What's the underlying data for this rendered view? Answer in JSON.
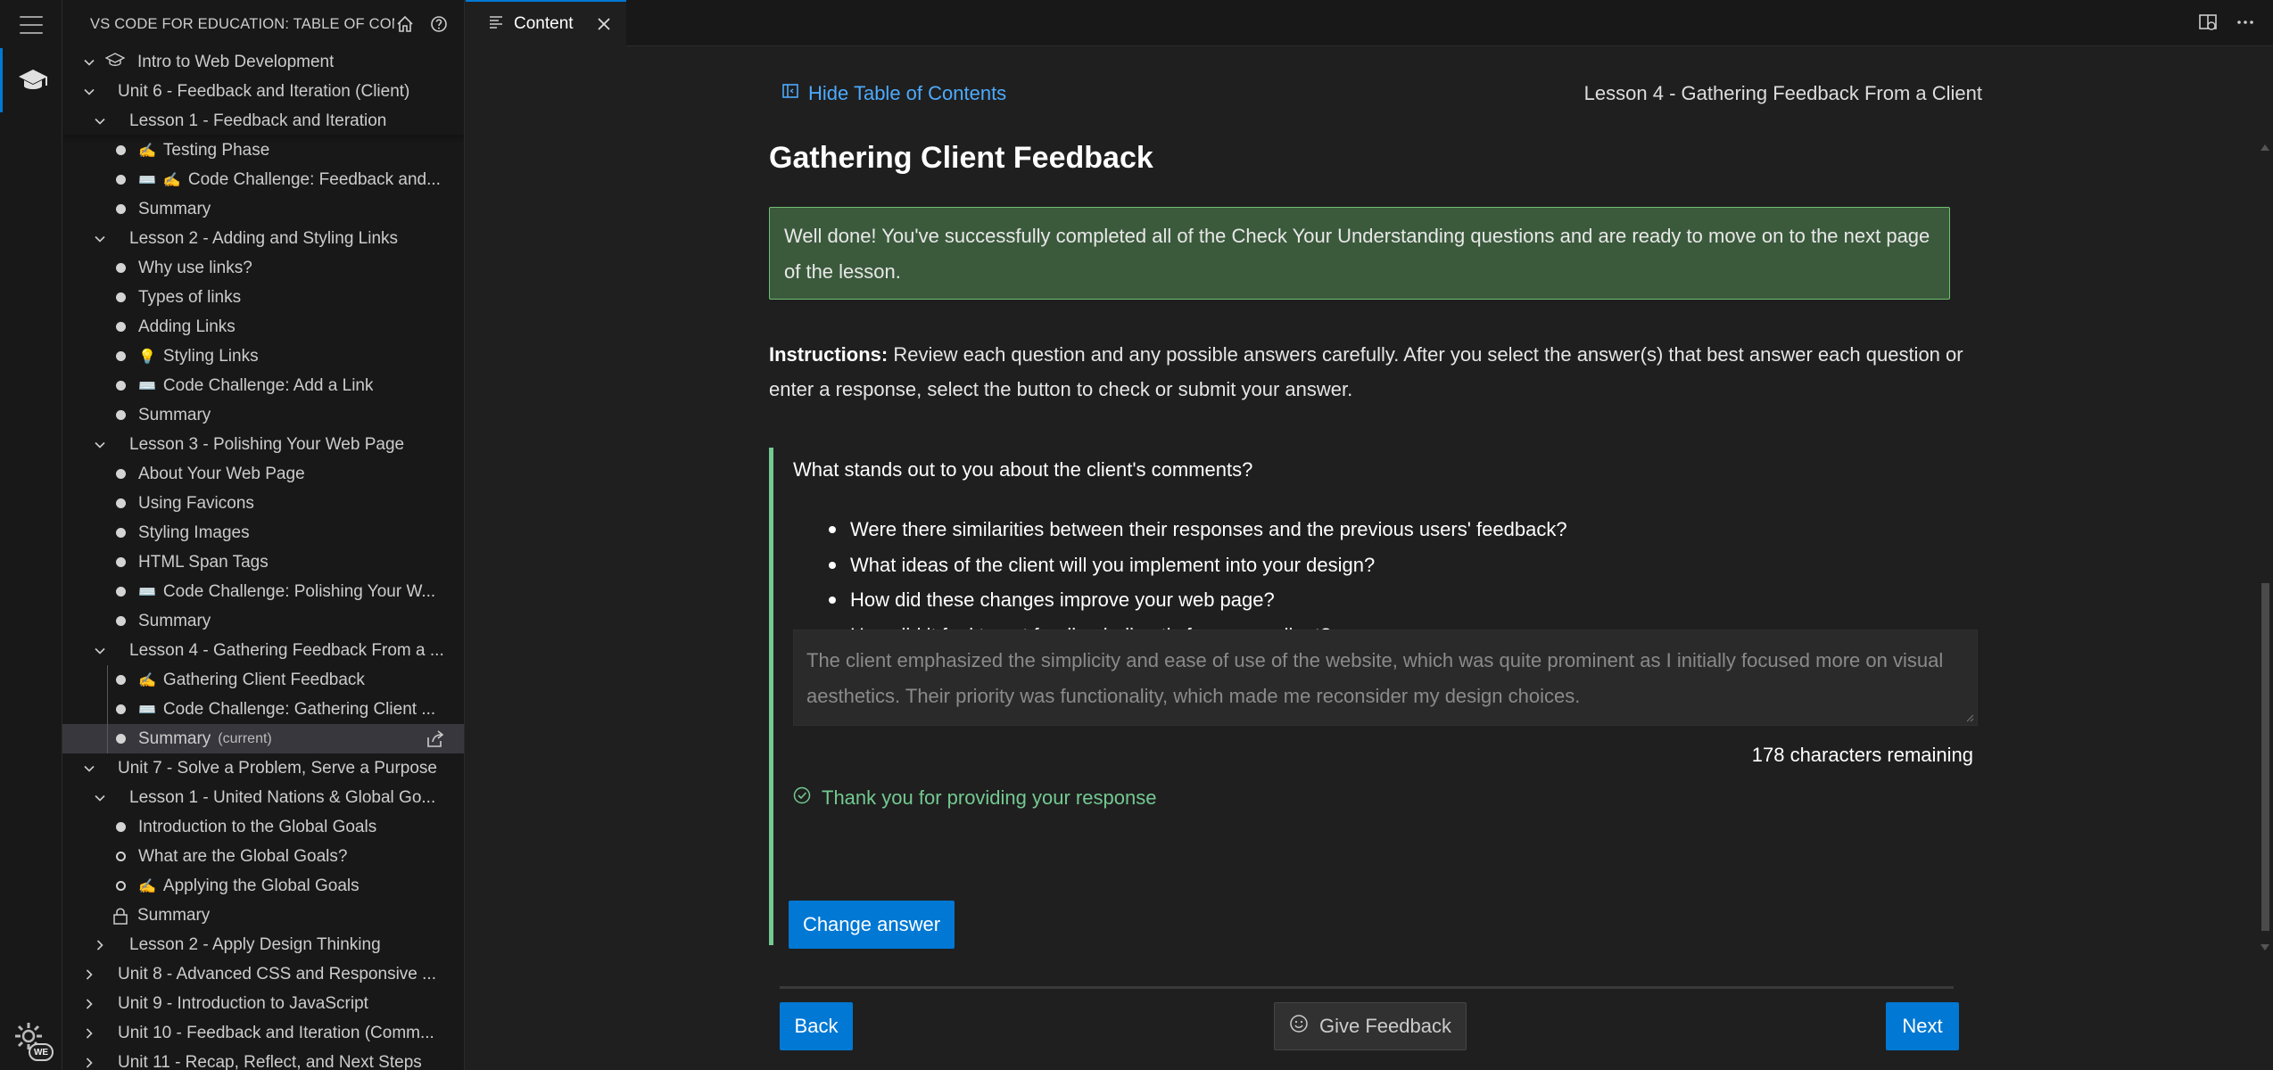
{
  "sidebar": {
    "title": "VS CODE FOR EDUCATION: TABLE OF CON...",
    "tree": [
      {
        "label": "Intro to Web Development",
        "kind": "course"
      },
      {
        "label": "Unit 6 - Feedback and Iteration (Client)",
        "kind": "unit",
        "expanded": true
      },
      {
        "label": "Lesson 1 - Feedback and Iteration",
        "kind": "lesson",
        "expanded": true
      },
      {
        "label": "Testing Phase",
        "kind": "page",
        "status": "done",
        "icon": "writing-hand"
      },
      {
        "label": "Code Challenge: Feedback and...",
        "kind": "page",
        "status": "done",
        "icon": "keyboard-writing-hand"
      },
      {
        "label": "Summary",
        "kind": "page",
        "status": "done"
      },
      {
        "label": "Lesson 2 - Adding and Styling Links",
        "kind": "lesson",
        "expanded": true
      },
      {
        "label": "Why use links?",
        "kind": "page",
        "status": "done"
      },
      {
        "label": "Types of links",
        "kind": "page",
        "status": "done"
      },
      {
        "label": "Adding Links",
        "kind": "page",
        "status": "done"
      },
      {
        "label": "Styling Links",
        "kind": "page",
        "status": "done",
        "icon": "lightbulb"
      },
      {
        "label": "Code Challenge: Add a Link",
        "kind": "page",
        "status": "done",
        "icon": "keyboard"
      },
      {
        "label": "Summary",
        "kind": "page",
        "status": "done"
      },
      {
        "label": "Lesson 3 - Polishing Your Web Page",
        "kind": "lesson",
        "expanded": true
      },
      {
        "label": "About Your Web Page",
        "kind": "page",
        "status": "done"
      },
      {
        "label": "Using Favicons",
        "kind": "page",
        "status": "done"
      },
      {
        "label": "Styling Images",
        "kind": "page",
        "status": "done"
      },
      {
        "label": "HTML Span Tags",
        "kind": "page",
        "status": "done"
      },
      {
        "label": "Code Challenge: Polishing Your W...",
        "kind": "page",
        "status": "done",
        "icon": "keyboard"
      },
      {
        "label": "Summary",
        "kind": "page",
        "status": "done"
      },
      {
        "label": "Lesson 4 - Gathering Feedback From a ...",
        "kind": "lesson",
        "expanded": true
      },
      {
        "label": "Gathering Client Feedback",
        "kind": "page",
        "status": "done",
        "icon": "writing-hand"
      },
      {
        "label": "Code Challenge: Gathering Client ...",
        "kind": "page",
        "status": "done",
        "icon": "keyboard"
      },
      {
        "label": "Summary",
        "kind": "page",
        "status": "done",
        "current": true,
        "current_label": "(current)"
      },
      {
        "label": "Unit 7 - Solve a Problem, Serve a Purpose",
        "kind": "unit",
        "expanded": true
      },
      {
        "label": "Lesson 1 - United Nations & Global Go...",
        "kind": "lesson",
        "expanded": true
      },
      {
        "label": "Introduction to the Global Goals",
        "kind": "page",
        "status": "done"
      },
      {
        "label": "What are the Global Goals?",
        "kind": "page",
        "status": "open"
      },
      {
        "label": "Applying the Global Goals",
        "kind": "page",
        "status": "open",
        "icon": "writing-hand"
      },
      {
        "label": "Summary",
        "kind": "page",
        "status": "locked"
      },
      {
        "label": "Lesson 2 - Apply Design Thinking",
        "kind": "lesson",
        "expanded": false
      },
      {
        "label": "Unit 8 - Advanced CSS and Responsive ...",
        "kind": "unit",
        "expanded": false
      },
      {
        "label": "Unit 9 - Introduction to JavaScript",
        "kind": "unit",
        "expanded": false
      },
      {
        "label": "Unit 10 - Feedback and Iteration (Comm...",
        "kind": "unit",
        "expanded": false
      },
      {
        "label": "Unit 11 - Recap, Reflect, and Next Steps",
        "kind": "unit",
        "expanded": false
      }
    ]
  },
  "tab": {
    "label": "Content"
  },
  "content": {
    "toc_link": "Hide Table of Contents",
    "lesson_crumb": "Lesson 4 - Gathering Feedback From a Client",
    "title": "Gathering Client Feedback",
    "success_message": "Well done! You've successfully completed all of the Check Your Understanding questions and are ready to move on to the next page of the lesson.",
    "instructions_label": "Instructions:",
    "instructions_text": " Review each question and any possible answers carefully. After you select the answer(s) that best answer each question or enter a response, select the button to check or submit your answer.",
    "question": "What stands out to you about the client's comments?",
    "bullets": [
      "Were there similarities between their responses and the previous users' feedback?",
      "What ideas of the client will you implement into your design?",
      "How did these changes improve your web page?",
      "How did it feel to get feedback directly from your client?"
    ],
    "answer": "The client emphasized the simplicity and ease of use of the website, which was quite prominent as I initially focused more on visual aesthetics. Their priority was functionality, which made me reconsider my design choices.",
    "chars_remaining": "178 characters remaining",
    "thanks": "Thank you for providing your response",
    "change_answer": "Change answer",
    "back": "Back",
    "give_feedback": "Give Feedback",
    "next": "Next"
  },
  "colors": {
    "accent": "#0078d4",
    "link": "#4daafc",
    "success": "#73c991",
    "success_bg": "#3b5a3c"
  }
}
